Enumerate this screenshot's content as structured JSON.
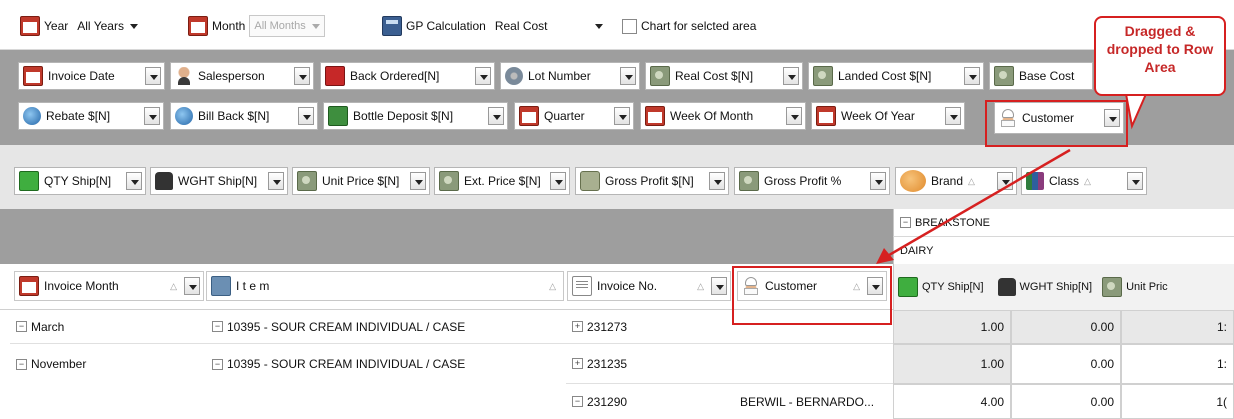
{
  "toolbar": {
    "year_label": "Year",
    "year_value": "All Years",
    "month_label": "Month",
    "month_value": "All Months",
    "gp_label": "GP Calculation",
    "gp_value": "Real Cost",
    "chart_label": "Chart for selcted area"
  },
  "filter_fields": {
    "row1": [
      "Invoice Date",
      "Salesperson",
      "Back Ordered[N]",
      "Lot Number",
      "Real Cost $[N]",
      "Landed Cost $[N]",
      "Base Cost"
    ],
    "row2": [
      "Rebate $[N]",
      "Bill Back $[N]",
      "Bottle Deposit $[N]",
      "Quarter",
      "Week Of Month",
      "Week Of Year",
      "Customer"
    ]
  },
  "data_fields": [
    "QTY Ship[N]",
    "WGHT Ship[N]",
    "Unit Price $[N]",
    "Ext. Price $[N]",
    "Gross Profit $[N]",
    "Gross Profit %",
    "Brand",
    "Class"
  ],
  "column_header": {
    "brand": "BREAKSTONE",
    "class": "DAIRY"
  },
  "row_fields": [
    "Invoice Month",
    "I t e m",
    "Invoice No.",
    "Customer"
  ],
  "value_headers": [
    "QTY Ship[N]",
    "WGHT Ship[N]",
    "Unit Pric"
  ],
  "rows": [
    {
      "month": "March",
      "item": "10395 - SOUR CREAM INDIVIDUAL / CASE",
      "invoice": "231273",
      "customer": "",
      "qty": "1.00",
      "wght": "0.00",
      "unit": "1:"
    },
    {
      "month": "November",
      "item": "10395 - SOUR CREAM INDIVIDUAL / CASE",
      "invoice": "231235",
      "customer": "",
      "qty": "1.00",
      "wght": "0.00",
      "unit": "1:"
    },
    {
      "month": "",
      "item": "",
      "invoice": "231290",
      "customer": "BERWIL - BERNARDO...",
      "qty": "4.00",
      "wght": "0.00",
      "unit": "1("
    }
  ],
  "annotation": "Dragged & dropped to Row Area",
  "colors": {
    "accent": "#d62020",
    "area_gray": "#9e9e9e"
  }
}
